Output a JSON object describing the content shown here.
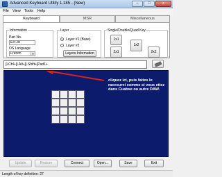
{
  "window": {
    "title": "Advanced Keyboard Utility 1.185 - (New)",
    "minimize": "–",
    "maximize": "□",
    "close": "x"
  },
  "menu": [
    "File",
    "View",
    "Tools",
    "Help"
  ],
  "tabs": [
    "Keyboard",
    "MSR",
    "Miscellaneous"
  ],
  "information": {
    "legend": "Information",
    "part_no_label": "Part No.",
    "part_no_value": "EX-28",
    "os_language_label": "OS Language",
    "os_language_value": "French"
  },
  "layer": {
    "legend": "Layer",
    "option1": "Layer #1 (Base)",
    "option2": "Layer #2",
    "info_button": "Layers Information"
  },
  "key_size": {
    "legend": "Single/Double/Quad Key",
    "buttons": [
      "1x1",
      "1x2",
      "2x1",
      "2x2"
    ]
  },
  "sequence": {
    "value": "[LCtrl+]LAlt+]LShift+]Pad1+"
  },
  "annotation": {
    "text": "cliquez ici, puis faites le raccourci comme si vous etiez dans Cuabse ou autre DAW."
  },
  "colors": {
    "display_background": "#0c1b6b",
    "arrow": "#d42424"
  },
  "bottom_buttons": [
    "Update",
    "Restore",
    "Connect",
    "Open...",
    "Save",
    "Exit"
  ],
  "status": {
    "text": "Length of key definition: 27"
  }
}
